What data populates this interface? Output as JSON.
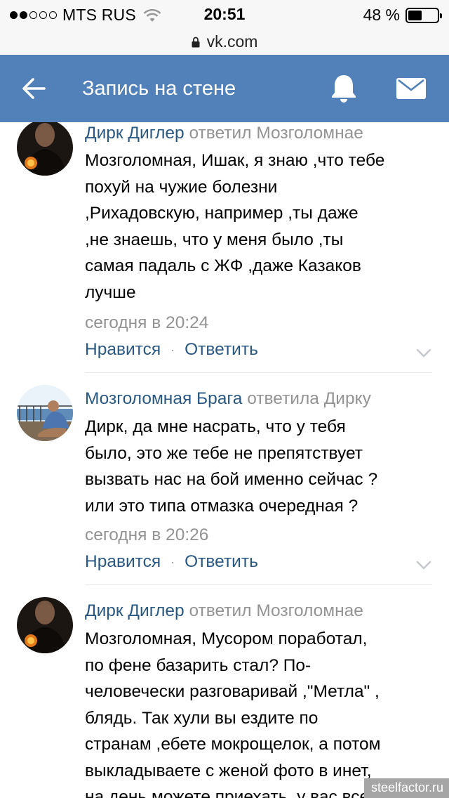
{
  "status_bar": {
    "carrier": "MTS RUS",
    "time": "20:51",
    "battery": "48 %",
    "battery_level": 0.48,
    "signal_bars": 2,
    "signal_total": 5
  },
  "url_bar": {
    "url": "vk.com",
    "icon": "lock-icon"
  },
  "header": {
    "title": "Запись на стене",
    "back_icon": "arrow-left-icon",
    "notifications_icon": "bell-icon",
    "messages_icon": "envelope-icon",
    "background": "#5181b8"
  },
  "comments": [
    {
      "author": "Дирк Диглер",
      "reply_to": "ответил Мозголомнае",
      "text_lines": [
        "Мозголомная, Ишак, я знаю ,что тебе",
        "похуй на чужие болезни",
        ",Рихадовскую, например ,ты даже",
        ",не знаешь, что у меня было ,ты",
        "самая падаль с ЖФ ,даже Казаков",
        "лучше"
      ],
      "time": "сегодня в 20:24",
      "like_label": "Нравится",
      "reply_label": "Ответить"
    },
    {
      "author": "Мозголомная Брага",
      "reply_to": "ответила Дирку",
      "text_lines": [
        "Дирк, да мне насрать, что у тебя",
        "было, это же тебе не препятствует",
        "вызвать нас на бой именно сейчас ?",
        "или это типа отмазка очередная ?"
      ],
      "time": "сегодня в 20:26",
      "like_label": "Нравится",
      "reply_label": "Ответить"
    },
    {
      "author": "Дирк Диглер",
      "reply_to": "ответил Мозголомнае",
      "text_lines": [
        "Мозголомная, Мусором поработал,",
        "по фене базарить стал? По-",
        "человечески разговаривай ,\"Метла\" ,",
        "блядь. Так хули вы ездите по",
        "странам ,ебете мокрощелок, а потом",
        "выкладываете с женой фото в инет,",
        "на день можете приехать, у вас все"
      ]
    }
  ],
  "watermark": "steelfactor.ru",
  "colors": {
    "link": "#2a5885",
    "muted": "#939393",
    "divider": "#e7e8ec"
  }
}
